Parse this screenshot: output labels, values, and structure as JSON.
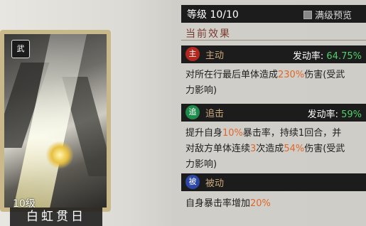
{
  "card": {
    "badge": "武",
    "level": "10级",
    "name": "白虹贯日"
  },
  "panel": {
    "level": "等级 10/10",
    "preview_label": "满级预览",
    "section_title": "当前效果"
  },
  "skills": [
    {
      "icon_char": "主",
      "icon_color": "#b3281e",
      "type": "主动",
      "rate_label": "发动率:",
      "rate_value": "64.75%",
      "desc_parts": [
        "对所在行最后单体造成",
        "230%",
        "伤害(受武",
        "力影响)"
      ]
    },
    {
      "icon_char": "追",
      "icon_color": "#1d8b4a",
      "type": "追击",
      "rate_label": "发动率:",
      "rate_value": "59%",
      "desc_parts": [
        "提升自身",
        "10%",
        "暴击率，持续1回合，并",
        "对敌方单体连续",
        "3",
        "次造成",
        "54%",
        "伤害(受武",
        "力影响)"
      ]
    },
    {
      "icon_char": "被",
      "icon_color": "#2c47a8",
      "type": "被动",
      "desc_parts": [
        "自身暴击率增加",
        "20%"
      ]
    }
  ],
  "colors": {
    "rate_value": "#4fd06a",
    "highlight": "#e0672b"
  }
}
